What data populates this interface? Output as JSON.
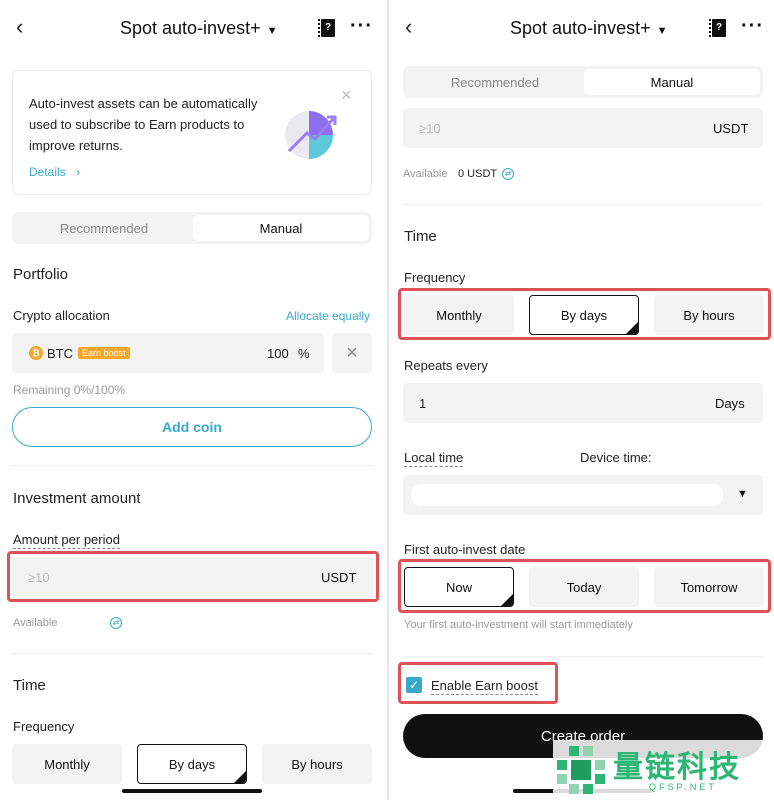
{
  "left": {
    "header": {
      "back_icon": "‹",
      "title": "Spot auto-invest+",
      "caret": "▼",
      "book_glyph": "?",
      "more_glyph": "···"
    },
    "banner": {
      "text": "Auto-invest assets can be automatically used to subscribe to Earn products to improve returns.",
      "details_link": "Details",
      "details_chevron": "›",
      "close": "×"
    },
    "tabs": [
      "Recommended",
      "Manual"
    ],
    "portfolio": {
      "title": "Portfolio",
      "crypto_allocation_label": "Crypto allocation",
      "allocate_equally": "Allocate equally",
      "coin": {
        "symbol": "BTC",
        "icon_glyph": "₿",
        "badge": "Earn boost",
        "percent": "100",
        "percent_unit": "%",
        "remove": "×"
      },
      "remaining": "Remaining 0%/100%",
      "add_coin": "Add coin"
    },
    "investment": {
      "title": "Investment amount",
      "amount_label": "Amount per period",
      "amount_placeholder": "≥10",
      "amount_unit": "USDT",
      "available_label": "Available",
      "swap_glyph": "⇄"
    },
    "time": {
      "title": "Time",
      "frequency_label": "Frequency",
      "frequency_options": [
        "Monthly",
        "By days",
        "By hours"
      ]
    }
  },
  "right": {
    "header": {
      "back_icon": "‹",
      "title": "Spot auto-invest+",
      "caret": "▼",
      "book_glyph": "?",
      "more_glyph": "···"
    },
    "tabs": [
      "Recommended",
      "Manual"
    ],
    "amount_placeholder": "≥10",
    "amount_unit": "USDT",
    "available_label": "Available",
    "available_value": "0 USDT",
    "swap_glyph": "⇄",
    "time": {
      "title": "Time",
      "frequency_label": "Frequency",
      "frequency_options": [
        "Monthly",
        "By days",
        "By hours"
      ],
      "repeats_label": "Repeats every",
      "repeats_value": "1",
      "repeats_unit": "Days",
      "local_time_label": "Local time",
      "device_time_label": "Device time:",
      "select_caret": "▼",
      "first_date_label": "First auto-invest date",
      "first_date_options": [
        "Now",
        "Today",
        "Tomorrow"
      ],
      "first_date_hint": "Your first auto-investment will start immediately"
    },
    "earn_boost": {
      "check_glyph": "✓",
      "label": "Enable Earn boost"
    },
    "create_order": "Create order"
  },
  "watermark": {
    "text": "量链科技",
    "sub": "QFSP.NET"
  },
  "colors": {
    "accent": "#3aa9c9",
    "highlight": "#e05255",
    "earn_badge": "#f5a623",
    "watermark": "#2bb673"
  }
}
